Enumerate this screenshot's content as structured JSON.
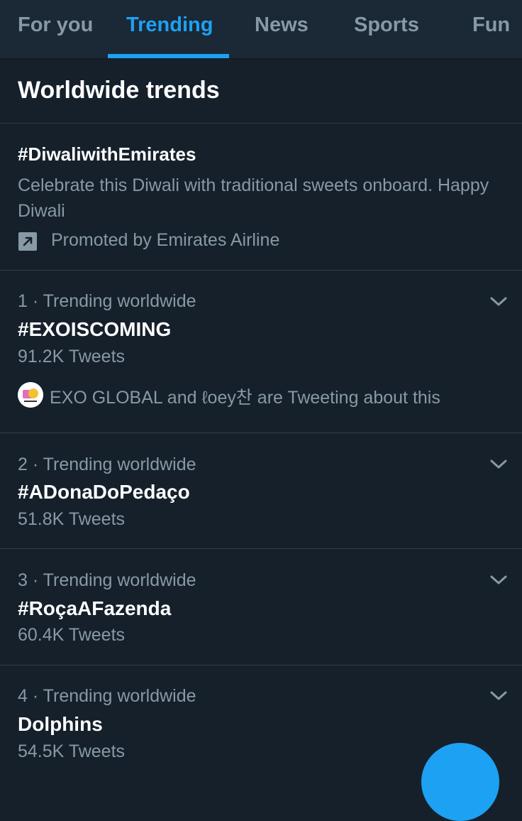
{
  "tabs": [
    {
      "label": "For you",
      "active": false
    },
    {
      "label": "Trending",
      "active": true
    },
    {
      "label": "News",
      "active": false
    },
    {
      "label": "Sports",
      "active": false
    },
    {
      "label": "Fun",
      "active": false
    }
  ],
  "section_title": "Worldwide trends",
  "promoted": {
    "hashtag": "#DiwaliwithEmirates",
    "description": "Celebrate this Diwali with traditional sweets onboard. Happy Diwali",
    "promoted_by": "Promoted by Emirates Airline",
    "icon": "promoted-arrow-icon"
  },
  "trends": [
    {
      "meta": "1 · Trending worldwide",
      "name": "#EXOISCOMING",
      "count": "91.2K Tweets",
      "tweeting": "EXO GLOBAL and ℓoey찬 are Tweeting about this"
    },
    {
      "meta": "2 · Trending worldwide",
      "name": "#ADonaDoPedaço",
      "count": "51.8K Tweets"
    },
    {
      "meta": "3 · Trending worldwide",
      "name": "#RoçaAFazenda",
      "count": "60.4K Tweets"
    },
    {
      "meta": "4 · Trending worldwide",
      "name": "Dolphins",
      "count": "54.5K Tweets"
    }
  ],
  "colors": {
    "background": "#15202b",
    "tabbar": "#1b2836",
    "accent": "#1da1f2",
    "secondary_text": "#8899a6",
    "divider": "#2f3c48"
  }
}
